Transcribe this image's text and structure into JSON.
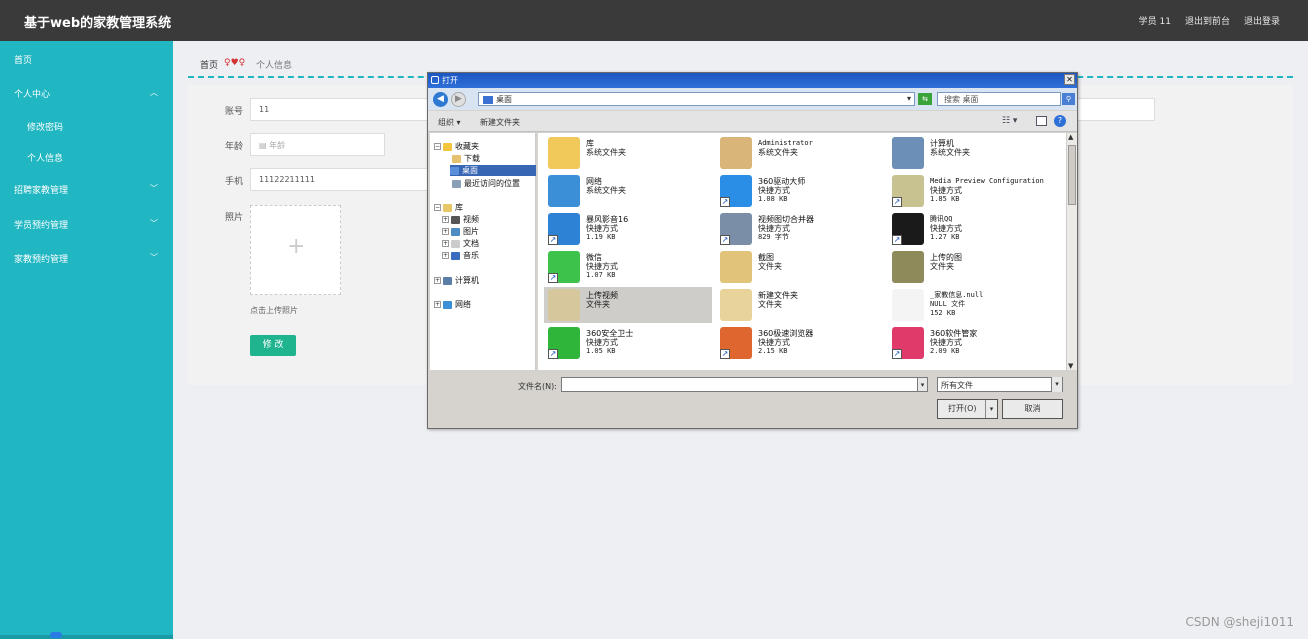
{
  "app": {
    "title": "基于web的家教管理系统"
  },
  "topnav": {
    "user": "学员 11",
    "back_front": "退出到前台",
    "logout": "退出登录"
  },
  "sidebar": {
    "home": "首页",
    "personal_center": "个人中心",
    "change_password": "修改密码",
    "personal_info": "个人信息",
    "tutor_recruit": "招聘家教管理",
    "student_booking": "学员预约管理",
    "tutor_booking": "家教预约管理"
  },
  "breadcrumb": {
    "home": "首页",
    "sep": "♀♥♀",
    "current": "个人信息"
  },
  "form": {
    "account_label": "账号",
    "account_value": "11",
    "age_label": "年龄",
    "age_placeholder": "年龄",
    "phone_label": "手机",
    "phone_value": "11122211111",
    "photo_label": "照片",
    "upload_tip": "点击上传照片",
    "submit": "修 改"
  },
  "dialog": {
    "title": "打开",
    "address": "桌面",
    "search_placeholder": "搜索 桌面",
    "organize": "组织 ▾",
    "new_folder": "新建文件夹",
    "nav": {
      "favorites": "收藏夹",
      "downloads": "下载",
      "desktop": "桌面",
      "recent": "最近访问的位置",
      "libraries": "库",
      "videos": "视频",
      "pictures": "图片",
      "documents": "文档",
      "music": "音乐",
      "computer": "计算机",
      "network": "网络"
    },
    "files": [
      {
        "name": "库",
        "l2": "系统文件夹",
        "l3": "",
        "color": "#f0c95a",
        "sc": false
      },
      {
        "name": "Administrator",
        "l2": "系统文件夹",
        "l3": "",
        "color": "#d9b57a",
        "sc": false
      },
      {
        "name": "计算机",
        "l2": "系统文件夹",
        "l3": "",
        "color": "#6c8fb7",
        "sc": false
      },
      {
        "name": "网络",
        "l2": "系统文件夹",
        "l3": "",
        "color": "#3b8fd6",
        "sc": false
      },
      {
        "name": "360驱动大师",
        "l2": "快捷方式",
        "l3": "1.08 KB",
        "color": "#2b8ee6",
        "sc": true
      },
      {
        "name": "Media Preview Configuration",
        "l2": "快捷方式",
        "l3": "1.85 KB",
        "color": "#c8c290",
        "sc": true
      },
      {
        "name": "暴风影音16",
        "l2": "快捷方式",
        "l3": "1.19 KB",
        "color": "#2d82d6",
        "sc": true
      },
      {
        "name": "视频图切合并器",
        "l2": "快捷方式",
        "l3": "829 字节",
        "color": "#7a8ea8",
        "sc": true
      },
      {
        "name": "腾讯QQ",
        "l2": "快捷方式",
        "l3": "1.27 KB",
        "color": "#1a1a1a",
        "sc": true
      },
      {
        "name": "微信",
        "l2": "快捷方式",
        "l3": "1.07 KB",
        "color": "#3dc24b",
        "sc": true
      },
      {
        "name": "截图",
        "l2": "文件夹",
        "l3": "",
        "color": "#e2c37a",
        "sc": false
      },
      {
        "name": "上传的图",
        "l2": "文件夹",
        "l3": "",
        "color": "#8f8a5a",
        "sc": false
      },
      {
        "name": "上传视频",
        "l2": "文件夹",
        "l3": "",
        "color": "#d7c79c",
        "sc": false
      },
      {
        "name": "新建文件夹",
        "l2": "文件夹",
        "l3": "",
        "color": "#e8d39a",
        "sc": false
      },
      {
        "name": "_家教信息.null",
        "l2": "NULL 文件",
        "l3": "152 KB",
        "color": "#f4f4f4",
        "sc": false
      },
      {
        "name": "360安全卫士",
        "l2": "快捷方式",
        "l3": "1.05 KB",
        "color": "#2fb63a",
        "sc": true
      },
      {
        "name": "360极速浏览器",
        "l2": "快捷方式",
        "l3": "2.15 KB",
        "color": "#e0662f",
        "sc": true
      },
      {
        "name": "360软件管家",
        "l2": "快捷方式",
        "l3": "2.09 KB",
        "color": "#e03a6a",
        "sc": true
      }
    ],
    "filename_label": "文件名(N):",
    "filetype": "所有文件",
    "open": "打开(O)",
    "cancel": "取消"
  },
  "watermark": "CSDN @sheji1011"
}
